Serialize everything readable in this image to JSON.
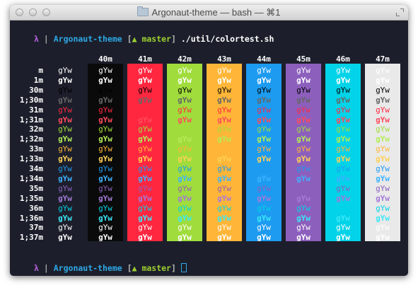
{
  "window": {
    "title": "Argonaut-theme — bash — ⌘1",
    "icons": {
      "folder": "folder-icon",
      "fullscreen": "fullscreen-icon"
    }
  },
  "prompt1": {
    "lambda": "λ",
    "separator": "|",
    "directory": "Argonaut-theme",
    "open_bracket": "[",
    "branch_symbol": "▲",
    "branch": "master",
    "close_bracket": "]",
    "command": "./util/colortest.sh"
  },
  "prompt2": {
    "lambda": "λ",
    "separator": "|",
    "directory": "Argonaut-theme",
    "open_bracket": "[",
    "branch_symbol": "▲",
    "branch": "master",
    "close_bracket": "]"
  },
  "sample_text": "gYw",
  "columns": [
    {
      "header": "",
      "bg": "transparent"
    },
    {
      "header": "40m",
      "bg": "#0a0a0a"
    },
    {
      "header": "41m",
      "bg": "#ff2740"
    },
    {
      "header": "42m",
      "bg": "#a0dc3c"
    },
    {
      "header": "43m",
      "bg": "#ffb638"
    },
    {
      "header": "44m",
      "bg": "#1d9bf0"
    },
    {
      "header": "45m",
      "bg": "#8d5fbd"
    },
    {
      "header": "46m",
      "bg": "#03d3e8"
    },
    {
      "header": "47m",
      "bg": "#e9e9e9"
    }
  ],
  "rows": [
    {
      "label": "m",
      "fg": "#ffffff"
    },
    {
      "label": "1m",
      "fg": "#ffffff"
    },
    {
      "label": "30m",
      "fg": "#000000"
    },
    {
      "label": "1;30m",
      "fg": "#666666"
    },
    {
      "label": "31m",
      "fg": "#ff2740"
    },
    {
      "label": "1;31m",
      "fg": "#ff4a5b"
    },
    {
      "label": "32m",
      "fg": "#a0dc3c"
    },
    {
      "label": "1;32m",
      "fg": "#b4ec58"
    },
    {
      "label": "33m",
      "fg": "#ffb638"
    },
    {
      "label": "1;33m",
      "fg": "#ffd156"
    },
    {
      "label": "34m",
      "fg": "#1d9bf0"
    },
    {
      "label": "1;34m",
      "fg": "#3db3ff"
    },
    {
      "label": "35m",
      "fg": "#8d5fbd"
    },
    {
      "label": "1;35m",
      "fg": "#a47ad8"
    },
    {
      "label": "36m",
      "fg": "#03d3e8"
    },
    {
      "label": "1;36m",
      "fg": "#3ae8f8"
    },
    {
      "label": "37m",
      "fg": "#ffffff"
    },
    {
      "label": "1;37m",
      "fg": "#ffffff"
    }
  ]
}
